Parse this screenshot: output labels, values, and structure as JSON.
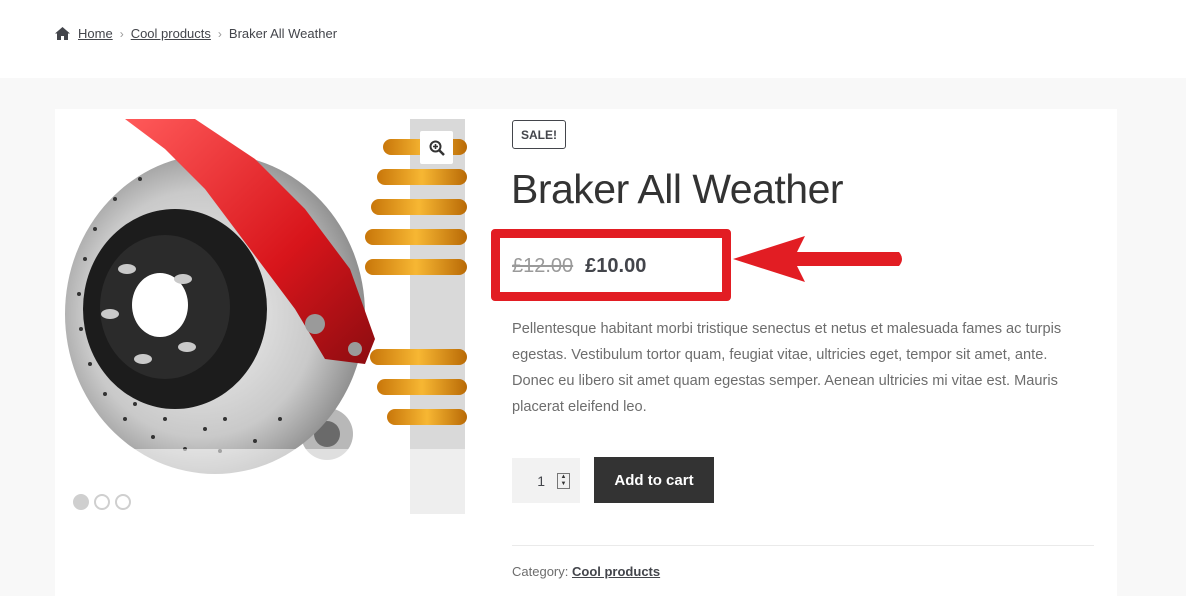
{
  "breadcrumb": {
    "icon": "home-icon",
    "items": [
      "Home",
      "Cool products"
    ],
    "current": "Braker All Weather"
  },
  "product": {
    "badge": "SALE!",
    "title": "Braker All Weather",
    "price_old": "£12.00",
    "price_new": "£10.00",
    "description": "Pellentesque habitant morbi tristique senectus et netus et malesuada fames ac turpis egestas. Vestibulum tortor quam, feugiat vitae, ultricies eget, tempor sit amet, ante. Donec eu libero sit amet quam egestas semper. Aenean ultricies mi vitae est. Mauris placerat eleifend leo.",
    "quantity": "1",
    "add_to_cart_label": "Add to cart",
    "category_label": "Category:",
    "category_value": "Cool products"
  },
  "gallery": {
    "zoom_icon": "magnifier-plus-icon",
    "slides": 3,
    "active_slide": 1
  },
  "annotation": {
    "highlight_color": "#e21d23"
  },
  "colors": {
    "text": "#43454b",
    "button": "#333333",
    "page_bg": "#f8f8f8"
  }
}
